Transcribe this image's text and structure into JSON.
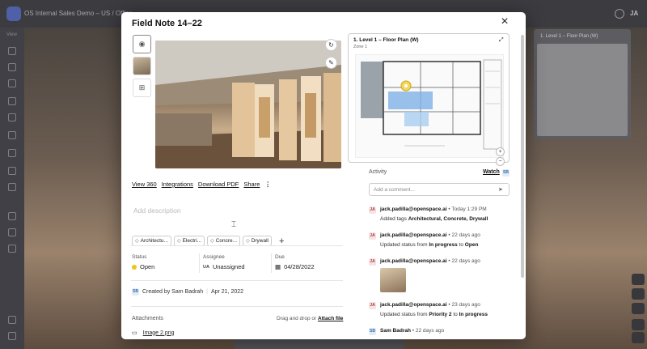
{
  "app": {
    "breadcrumb": "OS Internal Sales Demo – US  /  Office",
    "sidebar_view_label": "View",
    "user_initials": "JA",
    "minimap_title": "1. Level 1 – Floor Plan (W)"
  },
  "modal": {
    "title": "Field Note 14–22",
    "close_icon": "×",
    "description_placeholder": "Add description",
    "actions": [
      "View 360",
      "Integrations",
      "Download PDF",
      "Share"
    ],
    "more_icon": "⋮",
    "tags": [
      "Architectu...",
      "Electri...",
      "Concre...",
      "Drywall"
    ],
    "tag_add": "+",
    "status": {
      "label": "Status",
      "value": "Open",
      "color": "#f0c419"
    },
    "assignee": {
      "label": "Assignee",
      "badge": "UA",
      "value": "Unassigned"
    },
    "due": {
      "label": "Due",
      "value": "04/28/2022"
    },
    "created": {
      "badge": "SB",
      "text": "Created by Sam Badrah",
      "date": "Apr 21, 2022"
    },
    "attachments": {
      "label": "Attachments",
      "drag_text": "Drag and drop or",
      "attach_link": "Attach file",
      "files": [
        "Image 2.png"
      ]
    }
  },
  "plan": {
    "title": "1. Level 1 – Floor Plan (W)",
    "subtitle": "Zone 1",
    "zoom_in": "+",
    "zoom_out": "−"
  },
  "activity": {
    "header": "Activity",
    "watch_label": "Watch",
    "watch_badge": "SB",
    "comment_placeholder": "Add a comment...",
    "items": [
      {
        "avatar": "JA",
        "user": "jack.padilla@openspace.ai",
        "time": " • Today 1:29 PM",
        "pre": "Added tags ",
        "bold": "Architectural, Concrete, Drywall",
        "mid": "",
        "bold2": ""
      },
      {
        "avatar": "JA",
        "user": "jack.padilla@openspace.ai",
        "time": " • 22 days ago",
        "pre": "Updated status from ",
        "bold": "In progress",
        "mid": " to ",
        "bold2": "Open"
      },
      {
        "avatar": "JA",
        "user": "jack.padilla@openspace.ai",
        "time": " • 22 days ago",
        "pre": "",
        "bold": "",
        "mid": "",
        "bold2": ""
      },
      {
        "avatar": "JA",
        "user": "jack.padilla@openspace.ai",
        "time": " • 23 days ago",
        "pre": "Updated status from ",
        "bold": "Priority 2",
        "mid": " to ",
        "bold2": "In progress"
      },
      {
        "avatar": "SB",
        "user": "Sam Badrah",
        "time": " • 22 days ago",
        "pre": "",
        "bold": "",
        "mid": "",
        "bold2": ""
      }
    ]
  }
}
